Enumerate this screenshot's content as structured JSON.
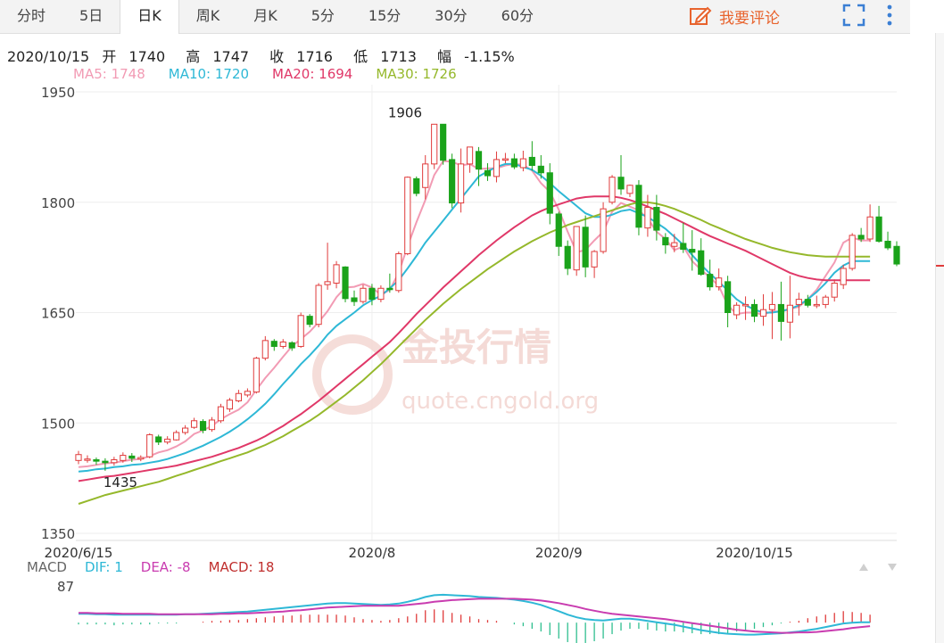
{
  "tabs": [
    {
      "label": "分时",
      "active": false
    },
    {
      "label": "5日",
      "active": false
    },
    {
      "label": "日K",
      "active": true
    },
    {
      "label": "周K",
      "active": false
    },
    {
      "label": "月K",
      "active": false
    },
    {
      "label": "5分",
      "active": false
    },
    {
      "label": "15分",
      "active": false
    },
    {
      "label": "30分",
      "active": false
    },
    {
      "label": "60分",
      "active": false
    }
  ],
  "comment_label": "我要评论",
  "info": {
    "date": "2020/10/15",
    "open_label": "开",
    "open": "1740",
    "high_label": "高",
    "high": "1747",
    "close_label": "收",
    "close": "1716",
    "low_label": "低",
    "low": "1713",
    "change_label": "幅",
    "change": "-1.15%"
  },
  "ma_legend": [
    {
      "text": "MA5: 1748",
      "color": "#f29bb4"
    },
    {
      "text": "MA10: 1720",
      "color": "#2eb8d6"
    },
    {
      "text": "MA20: 1694",
      "color": "#e03868"
    },
    {
      "text": "MA30: 1726",
      "color": "#95b82b"
    }
  ],
  "macd_legend": [
    {
      "text": "MACD",
      "color": "#666666"
    },
    {
      "text": "DIF: 1",
      "color": "#2eb8d6"
    },
    {
      "text": "DEA: -8",
      "color": "#c93cb0"
    },
    {
      "text": "MACD: 18",
      "color": "#c0302f"
    }
  ],
  "watermark": {
    "cn": "金投行情",
    "url": "quote.cngold.org"
  },
  "colors": {
    "up": "#e03c3c",
    "down": "#1aa31a",
    "accent": "#e8632d"
  },
  "chart_data": {
    "type": "candlestick",
    "ylim": [
      1350,
      1950
    ],
    "yticks": [
      "1950",
      "1800",
      "1650",
      "1500",
      "1350"
    ],
    "xticks": [
      {
        "label": "2020/6/15",
        "index": 0
      },
      {
        "label": "2020/8",
        "index": 33
      },
      {
        "label": "2020/9",
        "index": 54
      },
      {
        "label": "2020/10/15",
        "index": 76
      }
    ],
    "annotations": [
      {
        "text": "1906",
        "index": 35,
        "value": 1906
      },
      {
        "text": "1435",
        "index": 3,
        "value": 1435
      }
    ],
    "macd_axis_label": "87",
    "macd_ylim": [
      -40,
      87
    ],
    "candles": [
      [
        1449,
        1457,
        1444,
        1462
      ],
      [
        1451,
        1451,
        1446,
        1456
      ],
      [
        1450,
        1448,
        1443,
        1453
      ],
      [
        1448,
        1446,
        1435,
        1452
      ],
      [
        1446,
        1450,
        1442,
        1454
      ],
      [
        1449,
        1456,
        1446,
        1460
      ],
      [
        1455,
        1452,
        1447,
        1459
      ],
      [
        1451,
        1453,
        1448,
        1456
      ],
      [
        1454,
        1484,
        1452,
        1486
      ],
      [
        1481,
        1474,
        1470,
        1484
      ],
      [
        1474,
        1478,
        1471,
        1482
      ],
      [
        1477,
        1487,
        1476,
        1490
      ],
      [
        1487,
        1493,
        1484,
        1497
      ],
      [
        1494,
        1503,
        1492,
        1507
      ],
      [
        1502,
        1490,
        1486,
        1505
      ],
      [
        1491,
        1504,
        1488,
        1508
      ],
      [
        1503,
        1522,
        1500,
        1526
      ],
      [
        1519,
        1531,
        1515,
        1534
      ],
      [
        1530,
        1540,
        1528,
        1545
      ],
      [
        1538,
        1543,
        1535,
        1547
      ],
      [
        1542,
        1588,
        1540,
        1590
      ],
      [
        1588,
        1612,
        1585,
        1618
      ],
      [
        1611,
        1604,
        1598,
        1614
      ],
      [
        1604,
        1610,
        1601,
        1614
      ],
      [
        1609,
        1602,
        1598,
        1611
      ],
      [
        1604,
        1646,
        1602,
        1650
      ],
      [
        1645,
        1634,
        1630,
        1648
      ],
      [
        1634,
        1687,
        1630,
        1690
      ],
      [
        1688,
        1692,
        1681,
        1745
      ],
      [
        1690,
        1715,
        1683,
        1720
      ],
      [
        1712,
        1669,
        1664,
        1713
      ],
      [
        1670,
        1665,
        1659,
        1680
      ],
      [
        1665,
        1683,
        1662,
        1688
      ],
      [
        1683,
        1668,
        1660,
        1689
      ],
      [
        1668,
        1683,
        1664,
        1687
      ],
      [
        1683,
        1682,
        1677,
        1703
      ],
      [
        1680,
        1730,
        1677,
        1733
      ],
      [
        1730,
        1834,
        1728,
        1835
      ],
      [
        1832,
        1812,
        1808,
        1835
      ],
      [
        1820,
        1852,
        1804,
        1864
      ],
      [
        1852,
        1906,
        1845,
        1906
      ],
      [
        1906,
        1857,
        1851,
        1904
      ],
      [
        1858,
        1799,
        1792,
        1866
      ],
      [
        1799,
        1852,
        1786,
        1873
      ],
      [
        1852,
        1875,
        1840,
        1870
      ],
      [
        1869,
        1845,
        1822,
        1875
      ],
      [
        1843,
        1836,
        1829,
        1853
      ],
      [
        1835,
        1858,
        1827,
        1869
      ],
      [
        1858,
        1859,
        1853,
        1867
      ],
      [
        1859,
        1848,
        1845,
        1866
      ],
      [
        1847,
        1859,
        1842,
        1870
      ],
      [
        1861,
        1850,
        1843,
        1883
      ]
    ],
    "candles_part2": [
      [
        1849,
        1840,
        1832,
        1864
      ],
      [
        1840,
        1785,
        1770,
        1853
      ],
      [
        1784,
        1740,
        1727,
        1787
      ],
      [
        1740,
        1710,
        1701,
        1748
      ],
      [
        1708,
        1767,
        1700,
        1765
      ],
      [
        1766,
        1712,
        1698,
        1782
      ],
      [
        1712,
        1733,
        1697,
        1735
      ],
      [
        1733,
        1791,
        1730,
        1800
      ],
      [
        1800,
        1834,
        1797,
        1837
      ],
      [
        1834,
        1818,
        1810,
        1864
      ],
      [
        1812,
        1823,
        1807,
        1824
      ],
      [
        1823,
        1766,
        1755,
        1830
      ],
      [
        1765,
        1793,
        1753,
        1810
      ],
      [
        1793,
        1762,
        1748,
        1810
      ],
      [
        1752,
        1742,
        1730,
        1758
      ],
      [
        1740,
        1745,
        1732,
        1757
      ],
      [
        1744,
        1736,
        1731,
        1772
      ],
      [
        1736,
        1732,
        1707,
        1762
      ],
      [
        1734,
        1702,
        1700,
        1751
      ],
      [
        1702,
        1685,
        1680,
        1722
      ],
      [
        1685,
        1697,
        1680,
        1710
      ],
      [
        1692,
        1650,
        1630,
        1700
      ],
      [
        1647,
        1660,
        1641,
        1664
      ],
      [
        1660,
        1661,
        1640,
        1672
      ],
      [
        1661,
        1645,
        1637,
        1668
      ],
      [
        1645,
        1654,
        1632,
        1675
      ],
      [
        1654,
        1661,
        1614,
        1678
      ],
      [
        1661,
        1638,
        1612,
        1692
      ],
      [
        1637,
        1660,
        1615,
        1700
      ],
      [
        1661,
        1668,
        1646,
        1677
      ],
      [
        1668,
        1660,
        1657,
        1674
      ],
      [
        1661,
        1661,
        1656,
        1673
      ],
      [
        1661,
        1671,
        1656,
        1674
      ],
      [
        1671,
        1690,
        1665,
        1695
      ],
      [
        1688,
        1710,
        1682,
        1715
      ],
      [
        1710,
        1755,
        1707,
        1758
      ]
    ],
    "candles_tail": [
      [
        1755,
        1750,
        1746,
        1765
      ],
      [
        1750,
        1780,
        1746,
        1797
      ],
      [
        1780,
        1747,
        1745,
        1795
      ],
      [
        1747,
        1738,
        1735,
        1760
      ],
      [
        1740,
        1716,
        1713,
        1747
      ]
    ],
    "series": [
      {
        "name": "MA5",
        "color": "#f29bb4",
        "values": [
          1440,
          1441,
          1443,
          1445,
          1446,
          1448,
          1450,
          1451,
          1455,
          1460,
          1463,
          1468,
          1475,
          1485,
          1490,
          1496,
          1505,
          1512,
          1518,
          1528,
          1545,
          1561,
          1575,
          1590,
          1604,
          1614,
          1624,
          1637,
          1652,
          1671,
          1684,
          1685,
          1689,
          1684,
          1674,
          1681,
          1704,
          1740,
          1773,
          1803,
          1837,
          1856,
          1855,
          1850,
          1852,
          1845,
          1846,
          1846,
          1850,
          1852,
          1851,
          1843,
          1826,
          1814,
          1790,
          1760,
          1732,
          1735,
          1748,
          1760,
          1787,
          1799,
          1794,
          1789,
          1778,
          1760,
          1750,
          1735,
          1740,
          1720,
          1708,
          1698,
          1686,
          1660,
          1648,
          1650,
          1650,
          1647,
          1652,
          1651,
          1655,
          1658,
          1668,
          1681,
          1700,
          1718,
          1745,
          1752,
          1748,
          1748
        ]
      },
      {
        "name": "MA10",
        "color": "#2eb8d6",
        "values": [
          1434,
          1435,
          1437,
          1438,
          1440,
          1441,
          1443,
          1444,
          1446,
          1448,
          1451,
          1455,
          1459,
          1464,
          1469,
          1475,
          1481,
          1488,
          1496,
          1505,
          1515,
          1526,
          1539,
          1553,
          1566,
          1580,
          1592,
          1605,
          1620,
          1632,
          1641,
          1650,
          1660,
          1667,
          1673,
          1683,
          1694,
          1710,
          1727,
          1745,
          1760,
          1775,
          1790,
          1805,
          1820,
          1835,
          1842,
          1848,
          1852,
          1852,
          1848,
          1844,
          1836,
          1826,
          1815,
          1805,
          1795,
          1785,
          1780,
          1780,
          1783,
          1788,
          1790,
          1785,
          1780,
          1772,
          1764,
          1753,
          1742,
          1728,
          1715,
          1703,
          1692,
          1680,
          1668,
          1660,
          1654,
          1650,
          1650,
          1652,
          1655,
          1660,
          1668,
          1678,
          1690,
          1704,
          1714,
          1720,
          1720,
          1720
        ]
      },
      {
        "name": "MA20",
        "color": "#e03868",
        "values": [
          1421,
          1423,
          1425,
          1427,
          1428,
          1430,
          1432,
          1434,
          1436,
          1438,
          1440,
          1442,
          1445,
          1448,
          1451,
          1454,
          1458,
          1462,
          1466,
          1471,
          1476,
          1482,
          1489,
          1496,
          1504,
          1512,
          1521,
          1530,
          1540,
          1550,
          1560,
          1570,
          1580,
          1590,
          1600,
          1610,
          1622,
          1635,
          1648,
          1660,
          1672,
          1684,
          1695,
          1706,
          1717,
          1728,
          1738,
          1748,
          1757,
          1766,
          1774,
          1782,
          1788,
          1793,
          1797,
          1801,
          1805,
          1807,
          1808,
          1808,
          1808,
          1806,
          1803,
          1799,
          1794,
          1789,
          1784,
          1778,
          1772,
          1766,
          1760,
          1754,
          1749,
          1744,
          1739,
          1734,
          1728,
          1722,
          1716,
          1710,
          1704,
          1700,
          1697,
          1695,
          1694,
          1694,
          1694,
          1694,
          1694,
          1694
        ]
      },
      {
        "name": "MA30",
        "color": "#95b82b",
        "values": [
          1390,
          1394,
          1398,
          1402,
          1405,
          1408,
          1411,
          1414,
          1417,
          1420,
          1424,
          1428,
          1432,
          1436,
          1440,
          1444,
          1448,
          1452,
          1456,
          1460,
          1465,
          1470,
          1476,
          1482,
          1489,
          1496,
          1503,
          1511,
          1520,
          1529,
          1538,
          1548,
          1558,
          1569,
          1580,
          1592,
          1604,
          1616,
          1628,
          1640,
          1651,
          1662,
          1672,
          1682,
          1691,
          1700,
          1709,
          1717,
          1725,
          1733,
          1740,
          1747,
          1753,
          1759,
          1764,
          1769,
          1773,
          1777,
          1781,
          1785,
          1789,
          1793,
          1797,
          1800,
          1800,
          1798,
          1795,
          1791,
          1786,
          1781,
          1776,
          1770,
          1765,
          1760,
          1755,
          1750,
          1746,
          1742,
          1738,
          1735,
          1732,
          1730,
          1728,
          1727,
          1726,
          1726,
          1726,
          1726,
          1726,
          1726
        ]
      },
      {
        "name": "DIF",
        "color": "#2eb8d6",
        "values": [
          20,
          20,
          19,
          19,
          18,
          18,
          18,
          18,
          18,
          18,
          18,
          18,
          19,
          19,
          20,
          21,
          22,
          23,
          24,
          25,
          27,
          29,
          31,
          33,
          35,
          37,
          39,
          41,
          43,
          44,
          44,
          43,
          42,
          41,
          40,
          41,
          43,
          47,
          52,
          58,
          62,
          63,
          62,
          61,
          60,
          58,
          57,
          56,
          54,
          52,
          49,
          45,
          40,
          33,
          26,
          18,
          12,
          8,
          6,
          5,
          7,
          9,
          9,
          7,
          4,
          1,
          -2,
          -5,
          -9,
          -13,
          -17,
          -20,
          -23,
          -25,
          -26,
          -27,
          -27,
          -26,
          -25,
          -24,
          -22,
          -20,
          -17,
          -14,
          -10,
          -6,
          -2,
          0,
          1,
          1
        ]
      },
      {
        "name": "DEA",
        "color": "#c93cb0",
        "values": [
          22,
          22,
          21,
          21,
          21,
          20,
          20,
          20,
          20,
          19,
          19,
          19,
          19,
          19,
          19,
          19,
          20,
          20,
          21,
          21,
          22,
          23,
          24,
          25,
          27,
          28,
          30,
          32,
          34,
          35,
          36,
          37,
          38,
          38,
          38,
          38,
          38,
          40,
          42,
          44,
          47,
          49,
          51,
          52,
          53,
          54,
          54,
          54,
          54,
          54,
          53,
          52,
          50,
          47,
          44,
          40,
          36,
          31,
          27,
          23,
          20,
          18,
          16,
          14,
          12,
          10,
          8,
          5,
          2,
          -1,
          -4,
          -7,
          -10,
          -13,
          -16,
          -18,
          -20,
          -21,
          -22,
          -23,
          -23,
          -22,
          -22,
          -21,
          -19,
          -17,
          -15,
          -12,
          -10,
          -8
        ]
      }
    ],
    "macd_bars": [
      -4,
      -4,
      -4,
      -4,
      -6,
      -4,
      -4,
      -4,
      -4,
      -2,
      -2,
      -2,
      0,
      0,
      2,
      4,
      4,
      6,
      6,
      8,
      10,
      12,
      14,
      16,
      16,
      18,
      18,
      18,
      18,
      18,
      16,
      12,
      8,
      6,
      4,
      6,
      10,
      14,
      20,
      28,
      30,
      28,
      22,
      18,
      14,
      8,
      6,
      4,
      0,
      -4,
      -8,
      -14,
      -20,
      -28,
      -36,
      -44,
      -48,
      -46,
      -42,
      -36,
      -26,
      -18,
      -14,
      -14,
      -16,
      -18,
      -20,
      -20,
      -22,
      -24,
      -26,
      -26,
      -26,
      -24,
      -20,
      -18,
      -14,
      -10,
      -6,
      -2,
      2,
      4,
      10,
      14,
      18,
      22,
      26,
      24,
      22,
      18
    ]
  }
}
